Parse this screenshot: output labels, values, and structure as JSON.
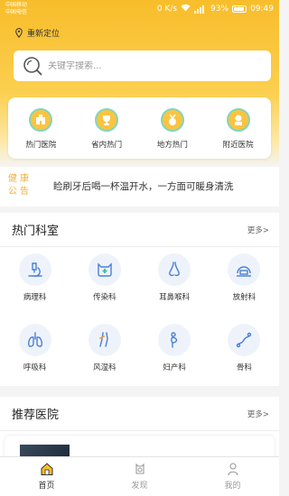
{
  "status_bar": {
    "carrier_1": "中国移动",
    "carrier_2": "中国电信",
    "speed": "0 K/s",
    "battery": "93%",
    "time": "09:49"
  },
  "location": {
    "label": "重新定位"
  },
  "search": {
    "placeholder": "关键字搜索..."
  },
  "quick_links": [
    {
      "label": "热门医院",
      "icon": "hospital-building-icon"
    },
    {
      "label": "省内热门",
      "icon": "trophy-icon"
    },
    {
      "label": "地方热门",
      "icon": "medal-icon"
    },
    {
      "label": "附近医院",
      "icon": "nearby-hospital-icon"
    }
  ],
  "notice": {
    "badge": "健康公告",
    "text": "睑刷牙后喝一杯温开水，一方面可暖身清洗"
  },
  "departments": {
    "title": "热门科室",
    "more": "更多>",
    "items": [
      {
        "label": "病理科",
        "icon": "microscope-icon"
      },
      {
        "label": "传染科",
        "icon": "cat-plus-icon"
      },
      {
        "label": "耳鼻喉科",
        "icon": "nose-icon"
      },
      {
        "label": "放射科",
        "icon": "radiology-icon"
      },
      {
        "label": "呼吸科",
        "icon": "lungs-icon"
      },
      {
        "label": "风湿科",
        "icon": "knee-icon"
      },
      {
        "label": "妇产科",
        "icon": "pregnant-icon"
      },
      {
        "label": "骨科",
        "icon": "bone-icon"
      }
    ]
  },
  "hospitals": {
    "title": "推荐医院",
    "more": "更多>"
  },
  "tabbar": [
    {
      "label": "首页",
      "icon": "home-icon",
      "active": true
    },
    {
      "label": "发现",
      "icon": "discover-icon",
      "active": false
    },
    {
      "label": "我的",
      "icon": "profile-icon",
      "active": false
    }
  ],
  "colors": {
    "brand_yellow": "#f8bd2a",
    "accent_teal": "#7fd6c0",
    "icon_blue": "#4a7fd6",
    "notice_orange": "#f0b03a"
  }
}
